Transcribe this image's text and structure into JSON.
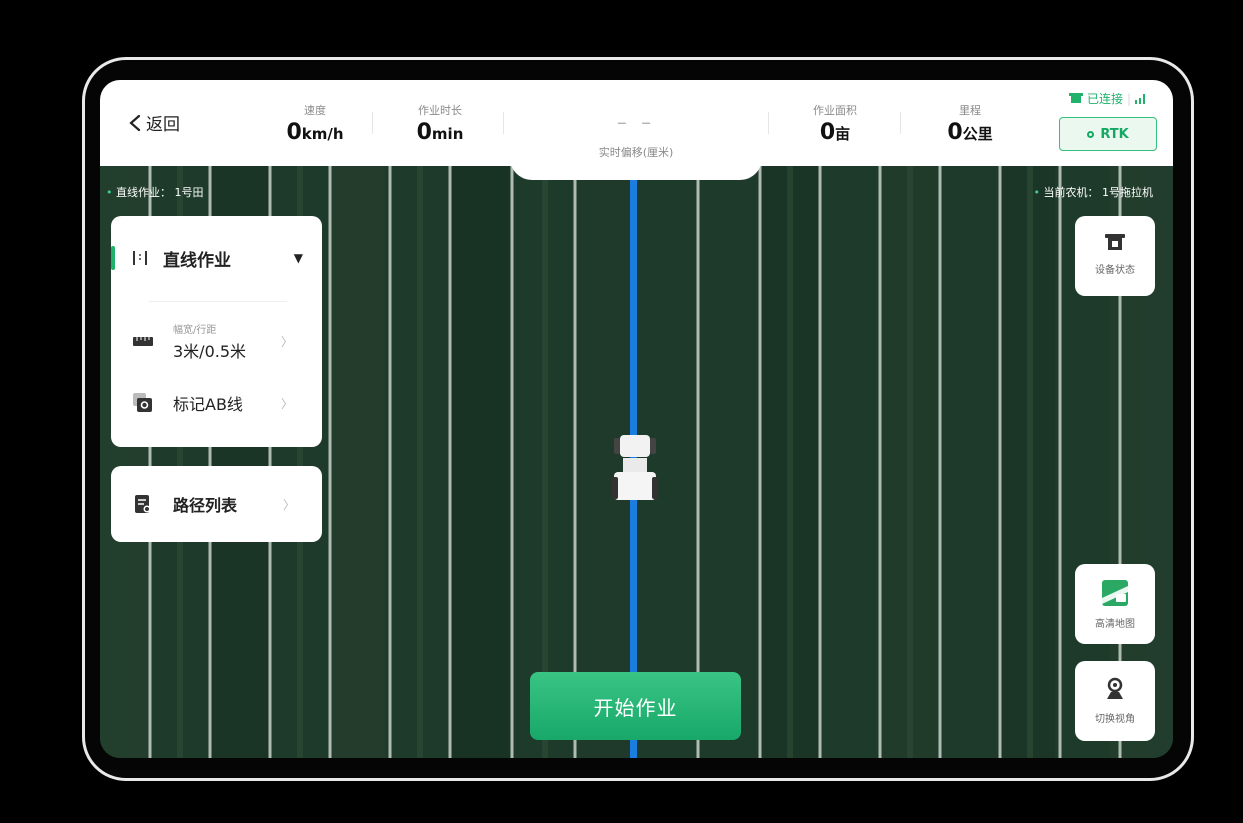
{
  "header": {
    "back_label": "返回",
    "speed": {
      "label": "速度",
      "value": "0",
      "unit": "km/h"
    },
    "duration": {
      "label": "作业时长",
      "value": "0",
      "unit": "min"
    },
    "offset": {
      "value": "– –",
      "label": "实时偏移(厘米)"
    },
    "area": {
      "label": "作业面积",
      "value": "0",
      "unit": "亩"
    },
    "mileage": {
      "label": "里程",
      "value": "0",
      "unit": "公里"
    },
    "connection": {
      "status": "已连接",
      "signal_icon": "signal-bars-icon"
    },
    "rtk_label": "RTK"
  },
  "map": {
    "mode_label": "直线作业：",
    "field_name": "1号田",
    "tractor_label": "当前农机：",
    "tractor_name": "1号拖拉机",
    "colors": {
      "path": "#1a7de0",
      "field": "#1f3a2b"
    }
  },
  "left_panel": {
    "mode_title": "直线作业",
    "width_label": "幅宽/行距",
    "width_value": "3米/0.5米",
    "mark_ab": "标记AB线",
    "path_list": "路径列表"
  },
  "right_buttons": {
    "device_status": "设备状态",
    "hd_map": "高清地图",
    "switch_view": "切换视角"
  },
  "start_button": "开始作业"
}
